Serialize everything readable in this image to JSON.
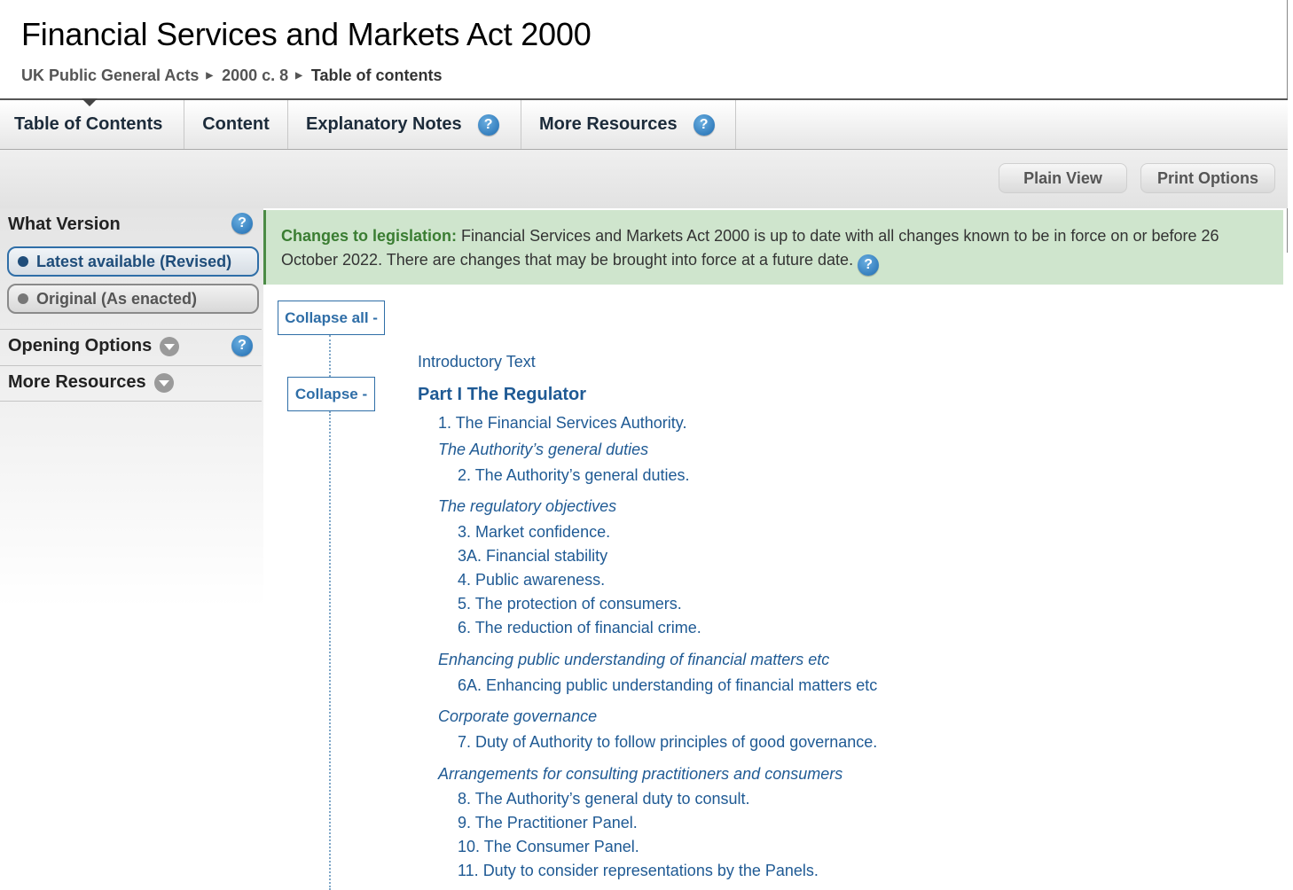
{
  "title": "Financial Services and Markets Act 2000",
  "breadcrumb": [
    "UK Public General Acts",
    "2000 c. 8",
    "Table of contents"
  ],
  "tabs": [
    {
      "label": "Table of Contents"
    },
    {
      "label": "Content"
    },
    {
      "label": "Explanatory Notes",
      "help": "?"
    },
    {
      "label": "More Resources",
      "help": "?"
    }
  ],
  "toolbar": {
    "plain_view": "Plain View",
    "print_options": "Print Options"
  },
  "sidebar": {
    "what_version": "What Version",
    "help": "?",
    "latest": "Latest available (Revised)",
    "original": "Original (As enacted)",
    "opening_options": "Opening Options",
    "more_resources": "More Resources"
  },
  "notice": {
    "label": "Changes to legislation:",
    "text": " Financial Services and Markets Act 2000 is up to date with all changes known to be in force on or before 26 October 2022. There are changes that may be brought into force at a future date.",
    "help": "?"
  },
  "controls": {
    "collapse_all": "Collapse all -",
    "collapse": "Collapse -"
  },
  "toc": {
    "intro": "Introductory Text",
    "part": "Part I The Regulator",
    "s1": "1.  The Financial Services Authority.",
    "h_general": "The Authority’s general duties",
    "s2": "2.  The Authority’s general duties.",
    "h_objectives": "The regulatory objectives",
    "s3": "3.  Market confidence.",
    "s3a": "3A.  Financial stability",
    "s4": "4.  Public awareness.",
    "s5": "5.  The protection of consumers.",
    "s6": "6.  The reduction of financial crime.",
    "h_enhancing": "Enhancing public understanding of financial matters etc",
    "s6a": "6A. Enhancing public understanding of financial matters etc",
    "h_corporate": "Corporate governance",
    "s7": "7.  Duty of Authority to follow principles of good governance.",
    "h_arrangements": "Arrangements for consulting practitioners and consumers",
    "s8": "8.  The Authority’s general duty to consult.",
    "s9": "9.  The Practitioner Panel.",
    "s10": "10.  The Consumer Panel.",
    "s11": "11.  Duty to consider representations by the Panels."
  }
}
